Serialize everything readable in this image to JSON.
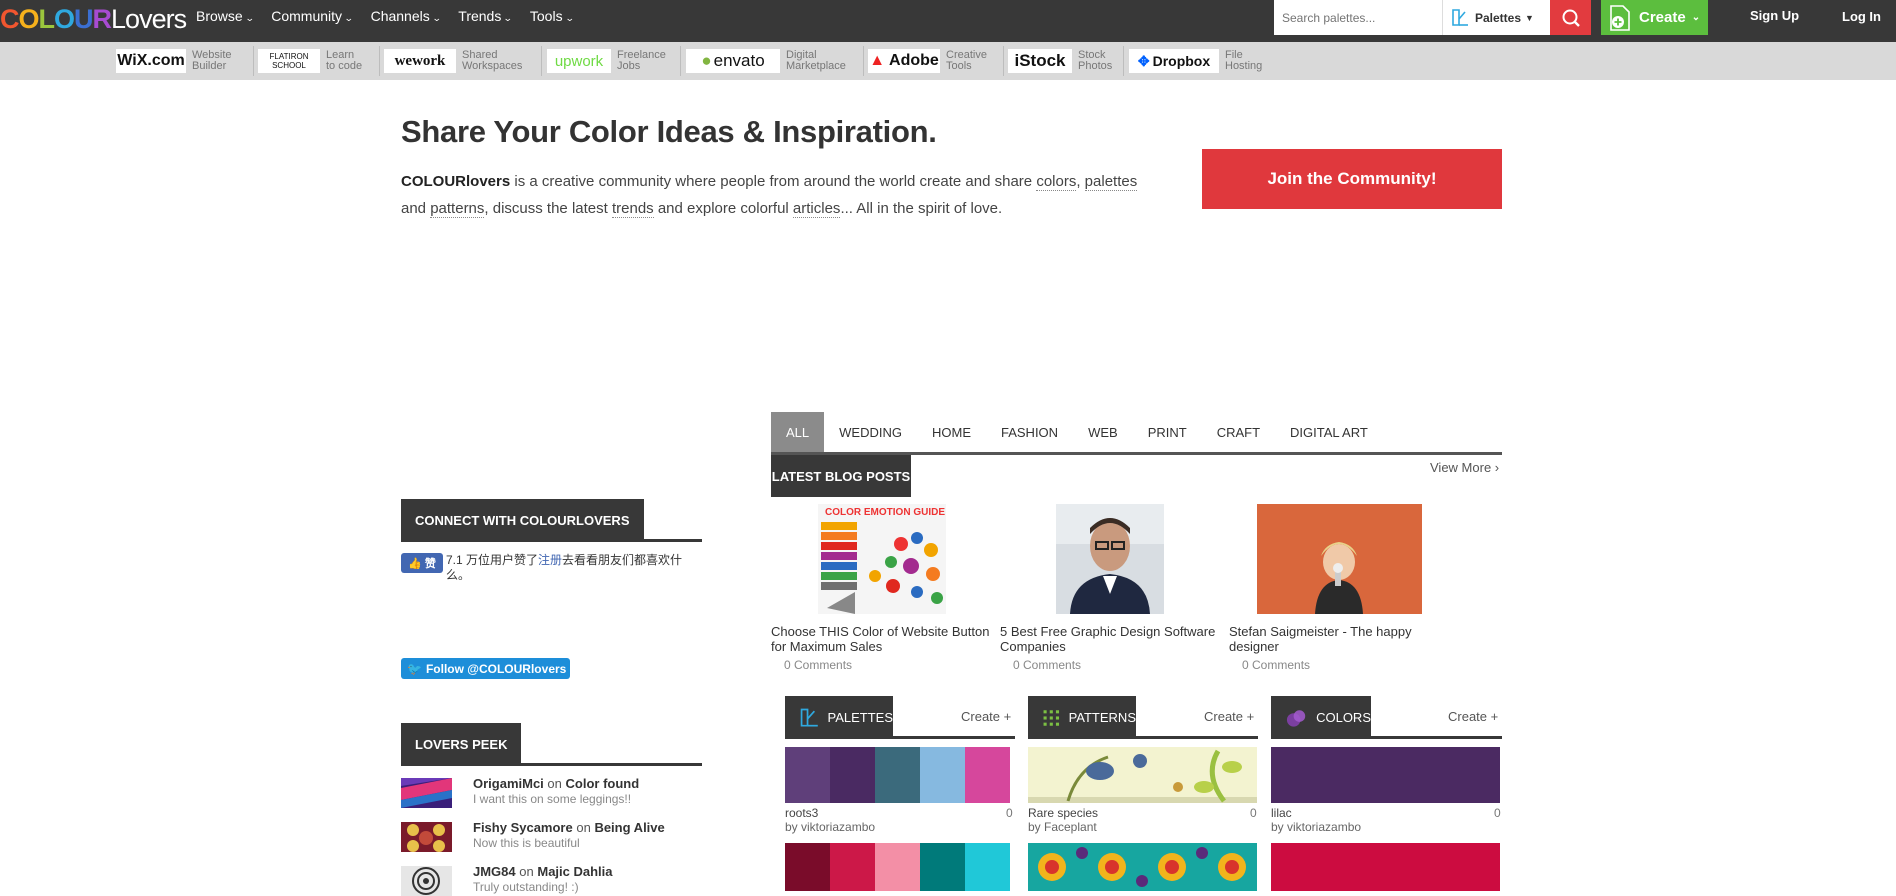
{
  "header": {
    "logo": {
      "c1": "C",
      "o1": "O",
      "l1": "L",
      "o2": "O",
      "u": "U",
      "r": "R",
      "lovers": "Lovers"
    },
    "nav": [
      {
        "label": "Browse"
      },
      {
        "label": "Community"
      },
      {
        "label": "Channels"
      },
      {
        "label": "Trends"
      },
      {
        "label": "Tools"
      }
    ],
    "search_placeholder": "Search palettes...",
    "search_type": "Palettes",
    "create_label": "Create",
    "signup": "Sign Up",
    "login": "Log In"
  },
  "sponsors": [
    {
      "brand": "WiX.com",
      "desc1": "Website",
      "desc2": "Builder"
    },
    {
      "brand": "FLATIRON SCHOOL",
      "desc1": "Learn",
      "desc2": "to code"
    },
    {
      "brand": "wework",
      "desc1": "Shared",
      "desc2": "Workspaces"
    },
    {
      "brand": "upwork",
      "desc1": "Freelance",
      "desc2": "Jobs"
    },
    {
      "brand": "envato",
      "desc1": "Digital",
      "desc2": "Marketplace"
    },
    {
      "brand": "Adobe",
      "desc1": "Creative",
      "desc2": "Tools"
    },
    {
      "brand": "iStock",
      "desc1": "Stock",
      "desc2": "Photos"
    },
    {
      "brand": "Dropbox",
      "desc1": "File",
      "desc2": "Hosting"
    }
  ],
  "hero": {
    "title": "Share Your Color Ideas & Inspiration.",
    "brand": "COLOURlovers",
    "t1": " is a creative community where people from around the world create and share ",
    "colors": "colors",
    "comma": ", ",
    "palettes": "palettes",
    "t2": "and ",
    "patterns": "patterns",
    "t3": ", discuss the latest ",
    "trends": "trends",
    "t4": " and explore colorful ",
    "articles": "articles",
    "t5": "... All in the spirit of love.",
    "join": "Join the Community!"
  },
  "tabs": [
    "ALL",
    "WEDDING",
    "HOME",
    "FASHION",
    "WEB",
    "PRINT",
    "CRAFT",
    "DIGITAL ART"
  ],
  "blog": {
    "heading": "LATEST BLOG POSTS",
    "view_more": "View More ›",
    "posts": [
      {
        "title": "Choose THIS Color of Website Button for Maximum Sales",
        "comments": "0 Comments",
        "thumb_label": "COLOR EMOTION GUIDE"
      },
      {
        "title": "5 Best Free Graphic Design Software Companies",
        "comments": "0 Comments"
      },
      {
        "title": "Stefan Saigmeister - The happy designer",
        "comments": "0 Comments"
      }
    ]
  },
  "sidebar": {
    "connect_heading": "CONNECT WITH COLOURLOVERS",
    "fb_like": "赞",
    "fb_text1": "7.1 万位用户赞了",
    "fb_link": "注册",
    "fb_text2": "去看看朋友们都喜欢什么。",
    "twitter": "Follow @COLOURlovers",
    "peek_heading": "LOVERS PEEK",
    "peek": [
      {
        "user": "OrigamiMci",
        "on": "on",
        "item": "Color found",
        "comment": "I want this on some leggings!!"
      },
      {
        "user": "Fishy Sycamore",
        "on": "on",
        "item": "Being Alive",
        "comment": "Now this is beautiful"
      },
      {
        "user": "JMG84",
        "on": "on",
        "item": "Majic Dahlia",
        "comment": "Truly outstanding! :)"
      }
    ]
  },
  "sections": {
    "palettes": {
      "title": "PALETTES",
      "create": "Create +",
      "name": "roots3",
      "by": "by viktoriazambo",
      "count": "0",
      "colors": [
        "#5f3f7a",
        "#4a2a62",
        "#3b6a7c",
        "#86b9e0",
        "#d6479c"
      ],
      "colors2": [
        "#7a0c2a",
        "#cc1848",
        "#f38fa6",
        "#007a7a",
        "#20c8d8"
      ]
    },
    "patterns": {
      "title": "PATTERNS",
      "create": "Create +",
      "name": "Rare species",
      "by": "by Faceplant",
      "count": "0"
    },
    "colors": {
      "title": "COLORS",
      "create": "Create +",
      "name": "lilac",
      "by": "by viktoriazambo",
      "count": "0",
      "color": "#4b2a62",
      "color2": "#cc0c40"
    }
  }
}
